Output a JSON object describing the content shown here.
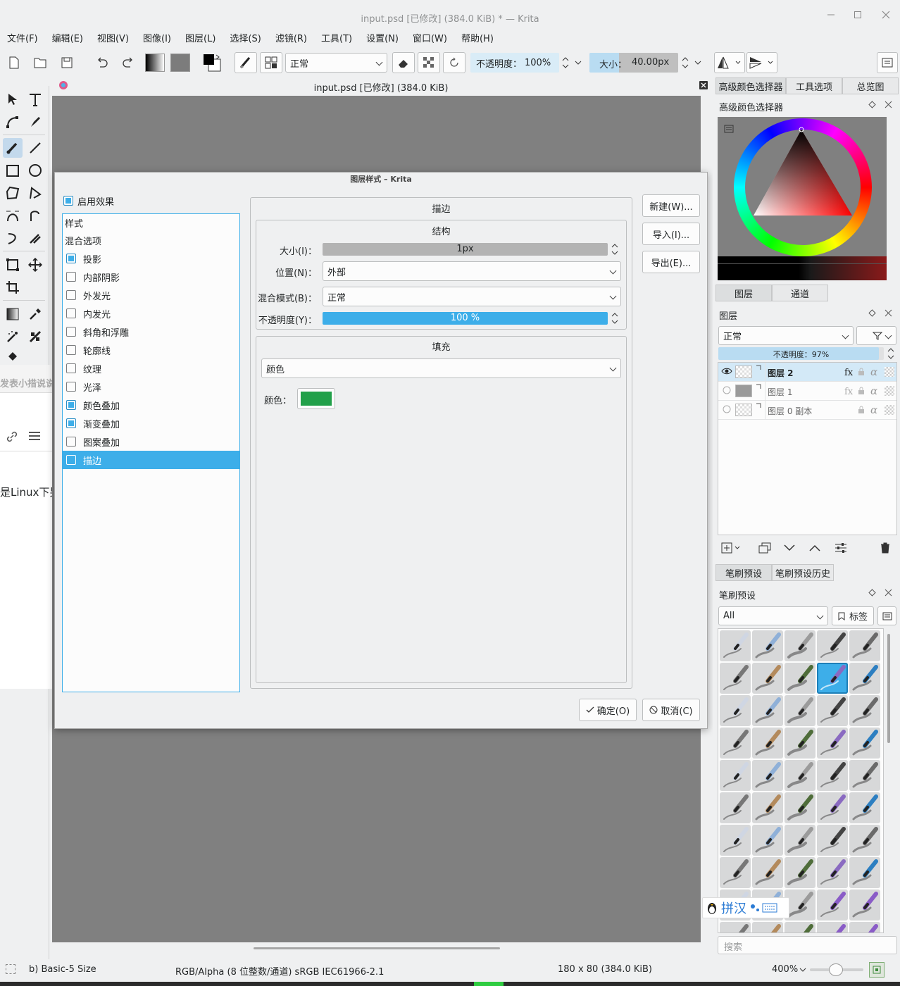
{
  "window": {
    "title": "input.psd [已修改]  (384.0 KiB) * — Krita"
  },
  "menu": [
    "文件(F)",
    "编辑(E)",
    "视图(V)",
    "图像(I)",
    "图层(L)",
    "选择(S)",
    "滤镜(R)",
    "工具(T)",
    "设置(N)",
    "窗口(W)",
    "帮助(H)"
  ],
  "toolbar": {
    "blend_mode": "正常",
    "opacity_label": "不透明度：",
    "opacity_value": "100%",
    "size_label": "大小：",
    "size_value": "40.00px"
  },
  "document": {
    "title": "input.psd [已修改]  (384.0 KiB)"
  },
  "background_text": {
    "a": "发表小措说说",
    "b": "是Linux下另"
  },
  "dialog": {
    "title": "图层样式 – Krita",
    "enable_effects": "启用效果",
    "styles": [
      {
        "label": "样式",
        "check": false,
        "checked": false,
        "selected": false
      },
      {
        "label": "混合选项",
        "check": false,
        "checked": false,
        "selected": false
      },
      {
        "label": "投影",
        "check": true,
        "checked": true,
        "selected": false
      },
      {
        "label": "内部阴影",
        "check": true,
        "checked": false,
        "selected": false
      },
      {
        "label": "外发光",
        "check": true,
        "checked": false,
        "selected": false
      },
      {
        "label": "内发光",
        "check": true,
        "checked": false,
        "selected": false
      },
      {
        "label": "斜角和浮雕",
        "check": true,
        "checked": false,
        "selected": false
      },
      {
        "label": "轮廓线",
        "check": true,
        "checked": false,
        "selected": false
      },
      {
        "label": "纹理",
        "check": true,
        "checked": false,
        "selected": false
      },
      {
        "label": "光泽",
        "check": true,
        "checked": false,
        "selected": false
      },
      {
        "label": "颜色叠加",
        "check": true,
        "checked": true,
        "selected": false
      },
      {
        "label": "渐变叠加",
        "check": true,
        "checked": true,
        "selected": false
      },
      {
        "label": "图案叠加",
        "check": true,
        "checked": false,
        "selected": false
      },
      {
        "label": "描边",
        "check": true,
        "checked": false,
        "selected": true
      }
    ],
    "stroke": {
      "header": "描边",
      "structure": "结构",
      "size_label": "大小(I)：",
      "size_value": "1px",
      "position_label": "位置(N)：",
      "position_value": "外部",
      "blend_label": "混合模式(B)：",
      "blend_value": "正常",
      "opacity_label": "不透明度(Y)：",
      "opacity_value": "100 %",
      "opacity_fraction": 1.0,
      "fill": "填充",
      "fill_type": "颜色",
      "color_label": "颜色：",
      "color": "#22a04a"
    },
    "buttons": {
      "new": "新建(W)...",
      "import": "导入(I)...",
      "export": "导出(E)...",
      "ok": "确定(O)",
      "cancel": "取消(C)"
    }
  },
  "dock": {
    "tabs": [
      "高级颜色选择器",
      "工具选项",
      "总览图"
    ],
    "color_selector_title": "高级颜色选择器",
    "layer_tabs": [
      "图层",
      "通道"
    ],
    "layers_title": "图层",
    "layer_blend": "正常",
    "layer_opacity": "不透明度：97%",
    "layer_opacity_fraction": 0.97,
    "layers": [
      {
        "name": "图层 2",
        "visible": true,
        "active": true
      },
      {
        "name": "图层 1",
        "visible": false,
        "active": false
      },
      {
        "name": "图层 0 副本",
        "visible": false,
        "active": false
      }
    ],
    "brush_tabs": [
      "笔刷预设",
      "笔刷预设历史"
    ],
    "brush_title": "笔刷预设",
    "brush_filter": "All",
    "tag_button": "标签",
    "search_placeholder": "搜索",
    "ime_text": "拼汉"
  },
  "status": {
    "brush": "b) Basic-5 Size",
    "color_space": "RGB/Alpha (8 位整数/通道)  sRGB IEC61966-2.1",
    "dimensions": "180 x 80 (384.0 KiB)",
    "zoom": "400%"
  },
  "colors": {
    "accent": "#3daee9",
    "selection": "#3daee9",
    "canvas": "#808080"
  }
}
